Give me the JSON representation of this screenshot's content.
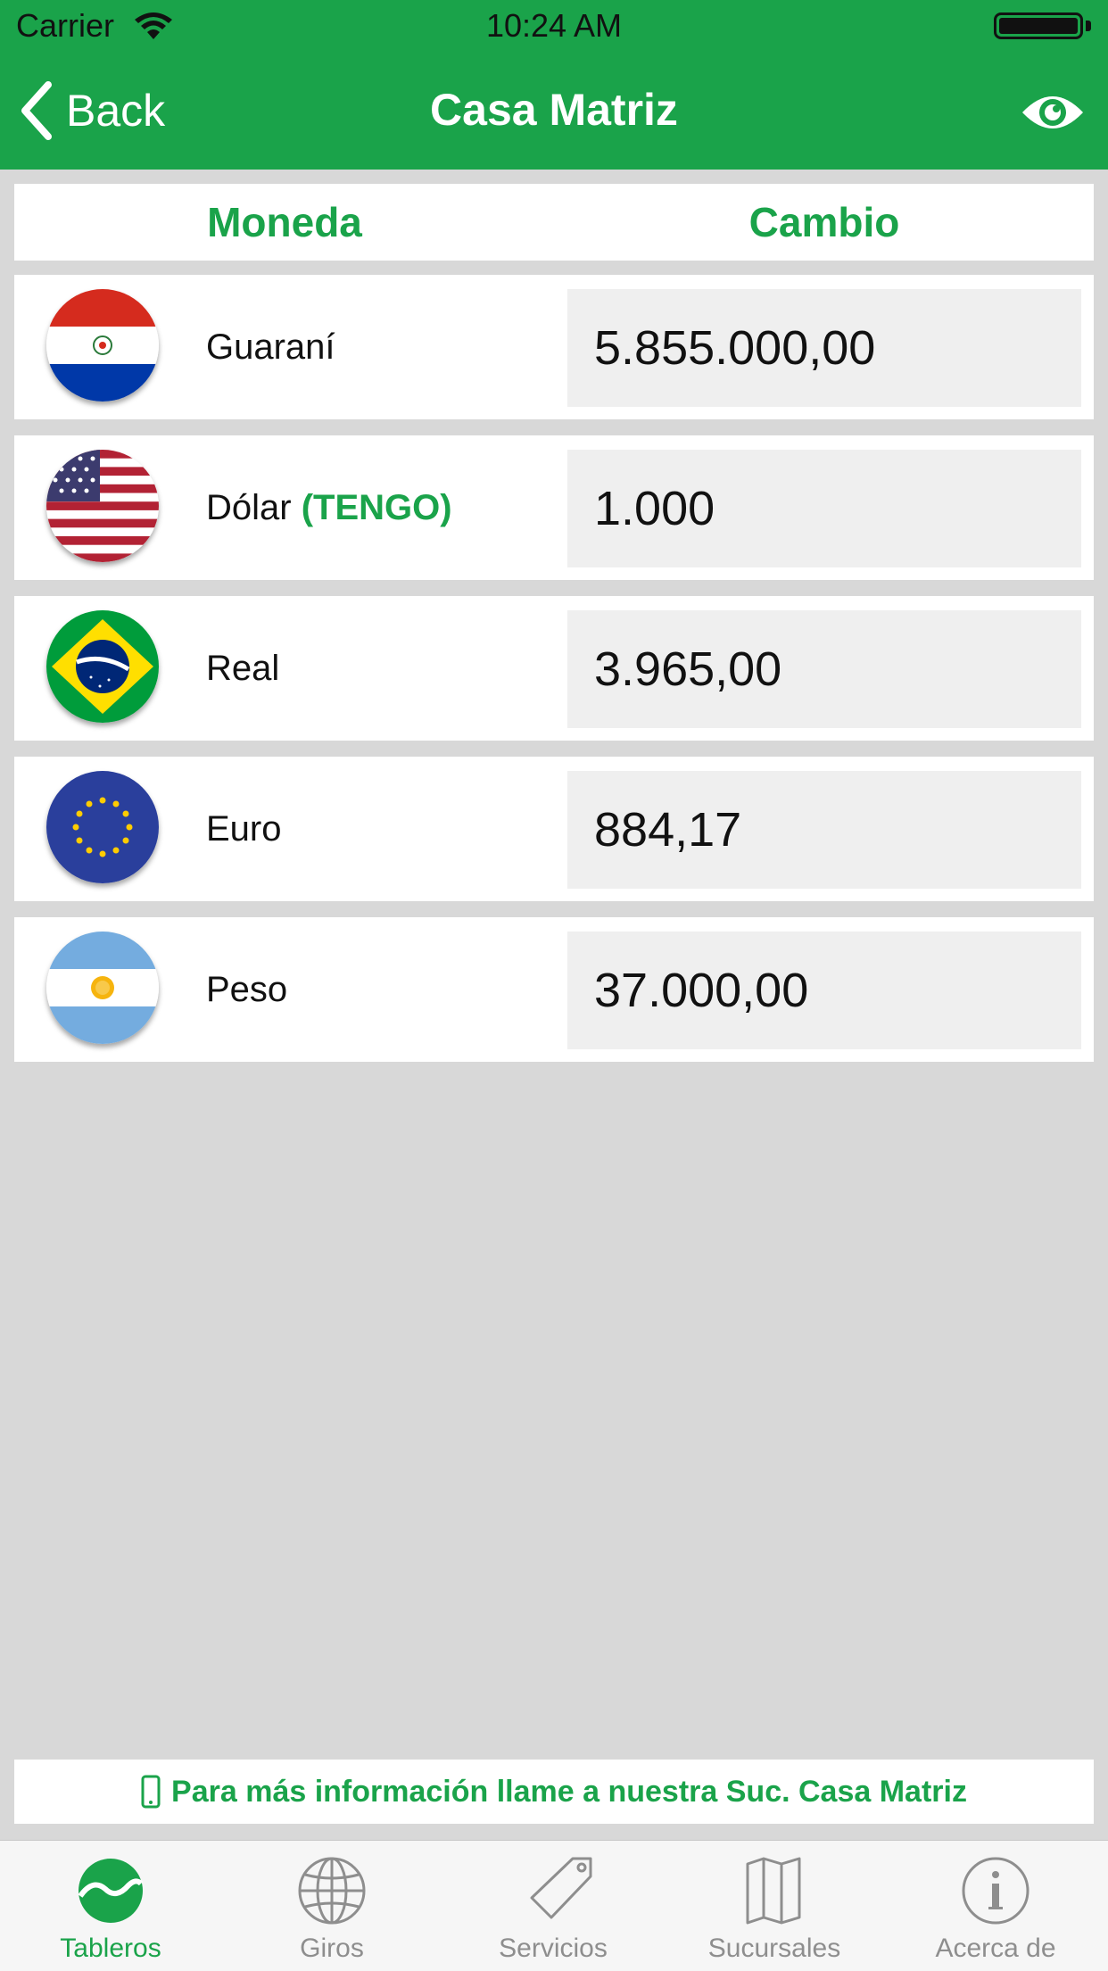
{
  "status": {
    "carrier": "Carrier",
    "time": "10:24 AM"
  },
  "nav": {
    "back_label": "Back",
    "title": "Casa Matriz"
  },
  "columns": {
    "currency": "Moneda",
    "rate": "Cambio"
  },
  "rows": [
    {
      "name": "Guaraní",
      "tag": "",
      "value": "5.855.000,00",
      "flag": "paraguay-flag-icon"
    },
    {
      "name": "Dólar",
      "tag": "(TENGO)",
      "value": "1.000",
      "flag": "usa-flag-icon"
    },
    {
      "name": "Real",
      "tag": "",
      "value": "3.965,00",
      "flag": "brazil-flag-icon"
    },
    {
      "name": "Euro",
      "tag": "",
      "value": "884,17",
      "flag": "eu-flag-icon"
    },
    {
      "name": "Peso",
      "tag": "",
      "value": "37.000,00",
      "flag": "argentina-flag-icon"
    }
  ],
  "info_banner": "Para más información llame a nuestra Suc. Casa Matriz",
  "tabs": [
    {
      "label": "Tableros",
      "icon": "dashboard-icon",
      "active": true
    },
    {
      "label": "Giros",
      "icon": "globe-icon",
      "active": false
    },
    {
      "label": "Servicios",
      "icon": "tag-icon",
      "active": false
    },
    {
      "label": "Sucursales",
      "icon": "map-icon",
      "active": false
    },
    {
      "label": "Acerca de",
      "icon": "info-icon",
      "active": false
    }
  ],
  "colors": {
    "brand_green": "#1aa34a",
    "background": "#d8d8d8",
    "value_box": "#efefef",
    "tab_inactive": "#8e8e8e"
  }
}
